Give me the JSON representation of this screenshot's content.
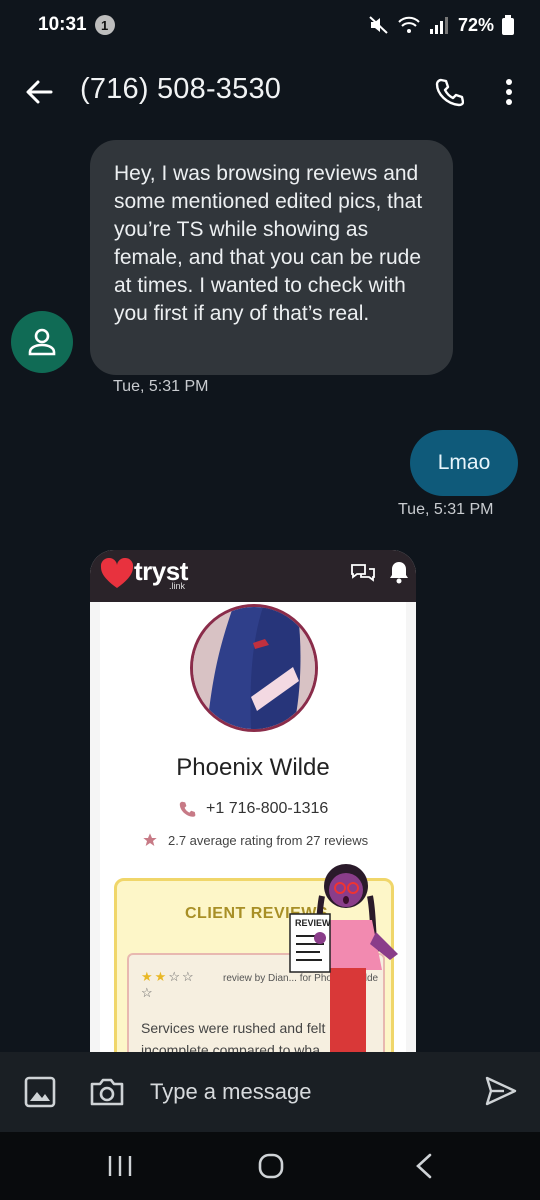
{
  "status_bar": {
    "time": "10:31",
    "notification_count": "1",
    "battery": "72%"
  },
  "header": {
    "title": "(716) 508-3530"
  },
  "conversation": {
    "incoming": {
      "text": "Hey, I was browsing reviews and some mentioned edited pics, that you’re TS while showing as female, and that you can be rude at times. I wanted to check with you first if any of that’s real.",
      "time": "Tue, 5:31 PM"
    },
    "outgoing": {
      "text": "Lmao",
      "time": "Tue, 5:31 PM"
    },
    "attachment": {
      "brand": "tryst",
      "brand_sub": ".link",
      "profile_name": "Phoenix Wilde",
      "phone": "+1 716-800-1316",
      "rating_text": "2.7 average rating from 27 reviews",
      "reviews_title": "CLIENT REVIEWS",
      "review_by": "review by Dian... for Phoenix Wilde",
      "review_stars": 2,
      "review_stars_max": 5,
      "review_text": "Services were rushed and felt incomplete compared to wha...",
      "review_sign": "REVIEW"
    }
  },
  "composer": {
    "placeholder": "Type a message"
  },
  "colors": {
    "background": "#0f151c",
    "incoming_bubble": "#31363b",
    "outgoing_bubble": "#0f5a7a",
    "avatar": "#106b55"
  }
}
